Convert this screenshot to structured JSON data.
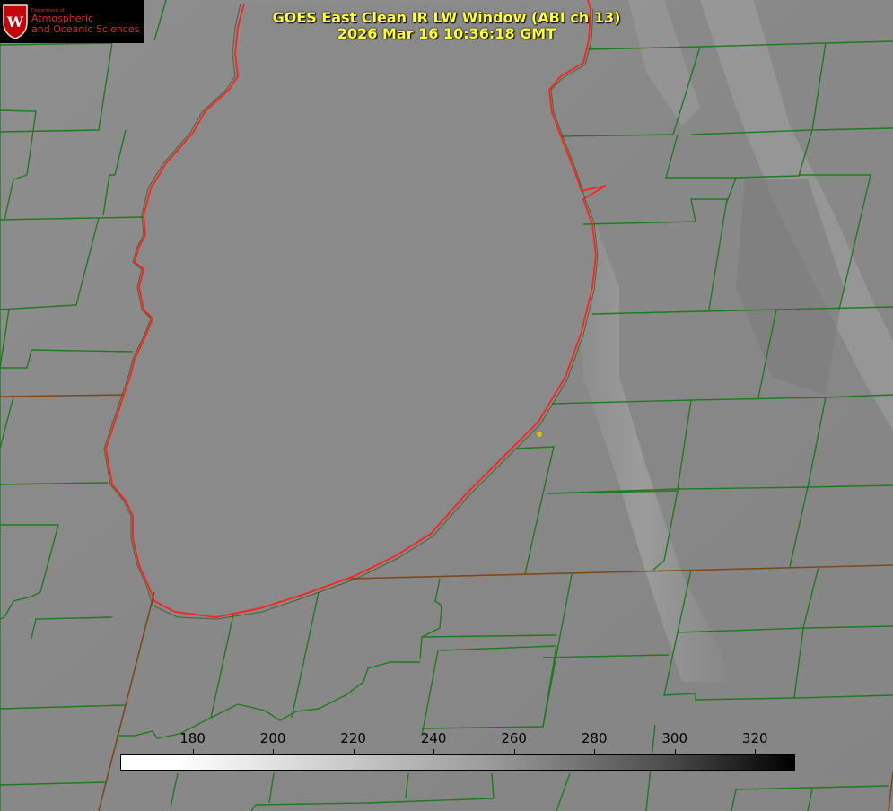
{
  "title": {
    "line1": "GOES East Clean IR LW Window (ABI ch 13)",
    "line2": "2026 Mar 16 10:36:18 GMT"
  },
  "logo": {
    "dept": "Department of",
    "line1": "Atmospheric",
    "line2": "and Oceanic Sciences",
    "crest_letter": "W",
    "color": "#c5050c"
  },
  "colorbar": {
    "ticks": [
      "180",
      "200",
      "220",
      "240",
      "260",
      "280",
      "300",
      "320"
    ],
    "min": 162,
    "max": 330
  },
  "colors": {
    "county_lines": "#1f7a1f",
    "coastline": "#ff2020",
    "state_lines": "#7a4a1a",
    "marker": "#d4c21a"
  }
}
